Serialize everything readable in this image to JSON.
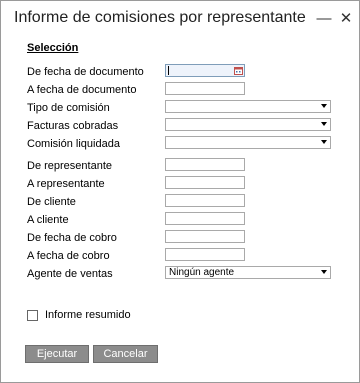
{
  "window": {
    "title": "Informe de comisiones por representante",
    "minimize_glyph": "—",
    "close_glyph": "✕"
  },
  "section": {
    "title": "Selección"
  },
  "fields": [
    {
      "label": "De fecha de documento",
      "kind": "date",
      "value": ""
    },
    {
      "label": "A fecha de documento",
      "kind": "text",
      "value": ""
    },
    {
      "label": "Tipo de comisión",
      "kind": "dropdown",
      "value": ""
    },
    {
      "label": "Facturas cobradas",
      "kind": "dropdown",
      "value": ""
    },
    {
      "label": "Comisión liquidada",
      "kind": "dropdown",
      "value": ""
    },
    {
      "label": "De representante",
      "kind": "text",
      "value": ""
    },
    {
      "label": "A representante",
      "kind": "text",
      "value": ""
    },
    {
      "label": "De cliente",
      "kind": "text",
      "value": ""
    },
    {
      "label": "A cliente",
      "kind": "text",
      "value": ""
    },
    {
      "label": "De fecha de cobro",
      "kind": "text",
      "value": ""
    },
    {
      "label": "A fecha de cobro",
      "kind": "text",
      "value": ""
    },
    {
      "label": "Agente de ventas",
      "kind": "dropdown",
      "value": "Ningún agente"
    }
  ],
  "checkbox": {
    "label": "Informe resumido",
    "checked": false
  },
  "buttons": {
    "execute_label": "Ejecutar",
    "cancel_label": "Cancelar"
  }
}
